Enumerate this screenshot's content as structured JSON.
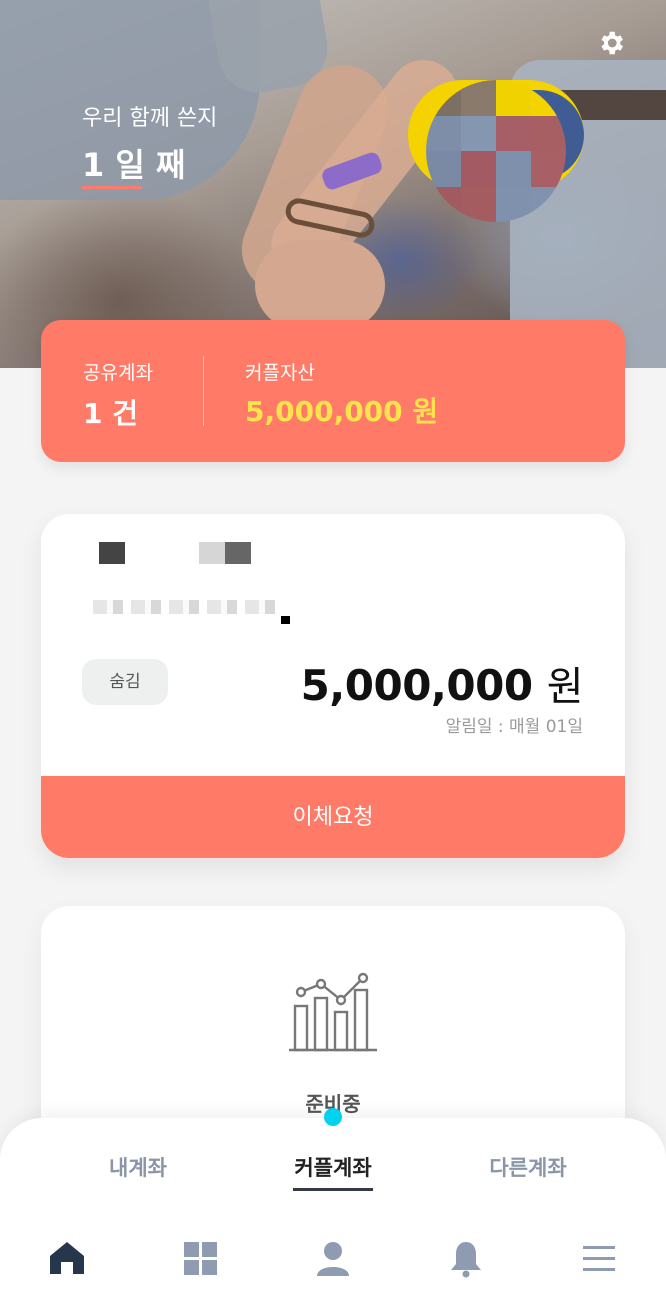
{
  "hero": {
    "subtitle": "우리 함께 쓴지",
    "days": "1 일 째",
    "settings_icon": "gear-icon"
  },
  "summary": {
    "shared_label": "공유계좌",
    "shared_value": "1 건",
    "assets_label": "커플자산",
    "assets_value": "5,000,000 원"
  },
  "account": {
    "hide_label": "숨김",
    "amount": "5,000,000",
    "unit": "원",
    "alarm": "알림일 : 매월 01일",
    "transfer_label": "이체요청"
  },
  "preparing": {
    "label": "준비중",
    "icon": "chart-icon"
  },
  "tabs": [
    {
      "label": "내계좌",
      "active": false
    },
    {
      "label": "커플계좌",
      "active": true
    },
    {
      "label": "다른계좌",
      "active": false
    }
  ],
  "nav": [
    "home-icon",
    "grid-icon",
    "person-icon",
    "bell-icon",
    "menu-icon"
  ],
  "colors": {
    "accent": "#ff7b68",
    "highlight": "#ffe34d",
    "tab_inactive": "#8a96a8",
    "indicator_dot": "#00d2f0"
  }
}
